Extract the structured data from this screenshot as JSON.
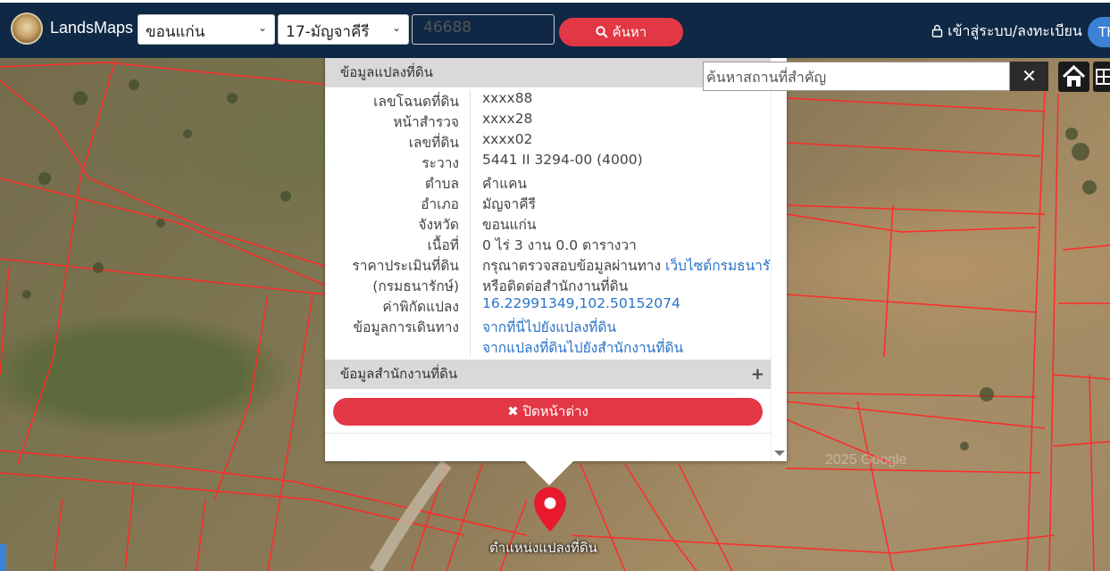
{
  "header": {
    "brand": "LandsMaps",
    "province": "ขอนแก่น",
    "district": "17-มัญจาคีรี",
    "parcel_number": "46688",
    "search_label": "ค้นหา",
    "login_label": "เข้าสู่ระบบ/ลงทะเบียน",
    "lang_label": "TH"
  },
  "popup": {
    "section_title": "ข้อมูลแปลงที่ดิน",
    "rows": [
      {
        "label": "เลขโฉนดที่ดิน",
        "value": "xxxx88"
      },
      {
        "label": "หน้าสำรวจ",
        "value": "xxxx28"
      },
      {
        "label": "เลขที่ดิน",
        "value": "xxxx02"
      },
      {
        "label": "ระวาง",
        "value": "5441 II 3294-00 (4000)"
      },
      {
        "label": "ตำบล",
        "value": "คำแคน"
      },
      {
        "label": "อำเภอ",
        "value": "มัญจาคีรี"
      },
      {
        "label": "จังหวัด",
        "value": "ขอนแก่น"
      },
      {
        "label": "เนื้อที่",
        "value": "0 ไร่ 3 งาน 0.0 ตารางวา"
      },
      {
        "label": "ราคาประเมินที่ดิน",
        "value": "กรุณาตรวจสอบข้อมูลผ่านทาง",
        "link": "เว็บไซต์กรมธนารักษ์"
      },
      {
        "label": "(กรมธนารักษ์)",
        "value": "หรือติดต่อสำนักงานที่ดิน"
      },
      {
        "label": "ค่าพิกัดแปลง",
        "value": "16.22991349,102.50152074"
      },
      {
        "label": "ข้อมูลการเดินทาง",
        "value": "จากที่นี่ไปยังแปลงที่ดิน"
      },
      {
        "label": "",
        "value": "จากแปลงที่ดินไปยังสำนักงานที่ดิน"
      }
    ],
    "office_section_title": "ข้อมูลสำนักงานที่ดิน",
    "close_label": "ปิดหน้าต่าง"
  },
  "map": {
    "place_search_placeholder": "ค้นหาสถานที่สำคัญ",
    "marker_label": "ตำแหน่งแปลงที่ดิน",
    "watermark": "2025 Google"
  },
  "colors": {
    "navbar": "#0f2845",
    "accent_red": "#e23744",
    "link_blue": "#2b73c7",
    "parcel_line": "#ff2020"
  }
}
